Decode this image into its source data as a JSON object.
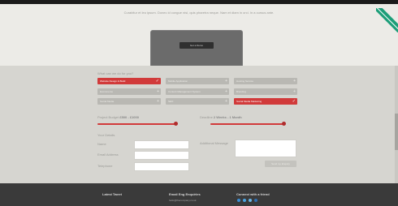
{
  "intro_text": "Curabitur et leo ipsum. Donec id congue nisl, quis pharetra neque. Nam et diam in orci. In a cursus ante.",
  "preview": {
    "button_label": "Get a Demo"
  },
  "question": "What can we do for you?",
  "options": [
    {
      "label": "Website Design & Build",
      "selected": true
    },
    {
      "label": "Mobile Application",
      "selected": false
    },
    {
      "label": "Hosting Service",
      "selected": false
    },
    {
      "label": "Ecommerce",
      "selected": false
    },
    {
      "label": "Content Management System",
      "selected": false
    },
    {
      "label": "Branding",
      "selected": false
    },
    {
      "label": "Social Media",
      "selected": false
    },
    {
      "label": "SEO",
      "selected": false
    },
    {
      "label": "Social Media Marketing",
      "selected": true
    }
  ],
  "sliders": {
    "budget": {
      "label": "Project Budget",
      "value": "£500 - £1000",
      "fill": 0.8
    },
    "deadline": {
      "label": "Deadline",
      "value": "2 Weeks - 1 Month",
      "fill": 0.85
    }
  },
  "form": {
    "heading": "Your Details",
    "name_label": "Name",
    "email_label": "Email Address",
    "phone_label": "Telephone",
    "message_label": "Additional Message",
    "send_label": "Send my Enquiry"
  },
  "footer": {
    "col1_head": "Latest Tweet",
    "col2_head": "Email Eng Enquiries",
    "col2_text": "hello@thecompany.co.uk",
    "col3_head": "Connect with a friend",
    "social_colors": [
      "#3b8fd6",
      "#4aa3e0",
      "#6cb8e6",
      "#2f6fb3"
    ]
  },
  "colors": {
    "accent": "#d13a3a",
    "ribbon": "#1d9e79"
  }
}
